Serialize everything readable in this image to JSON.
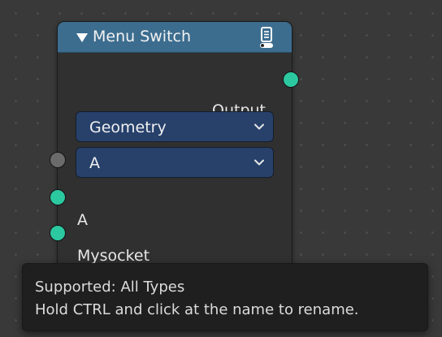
{
  "node": {
    "title": "Menu Switch",
    "header_color": "#3c6d8f",
    "output_label": "Output",
    "menu_dropdown": {
      "value": "Geometry"
    },
    "menu_input_dropdown": {
      "value": "A"
    },
    "inputs": [
      {
        "label": "A"
      },
      {
        "label": "Mysocket"
      }
    ],
    "socket_colors": {
      "geometry": "#2cc8a0",
      "menu": "#6b6b6b"
    },
    "icons": {
      "collapse": "triangle-down-icon",
      "header": "node-panel-icon",
      "dropdown": "chevron-down-icon"
    }
  },
  "tooltip": {
    "line1": "Supported: All Types",
    "line2": "Hold CTRL and click at the name to rename."
  }
}
